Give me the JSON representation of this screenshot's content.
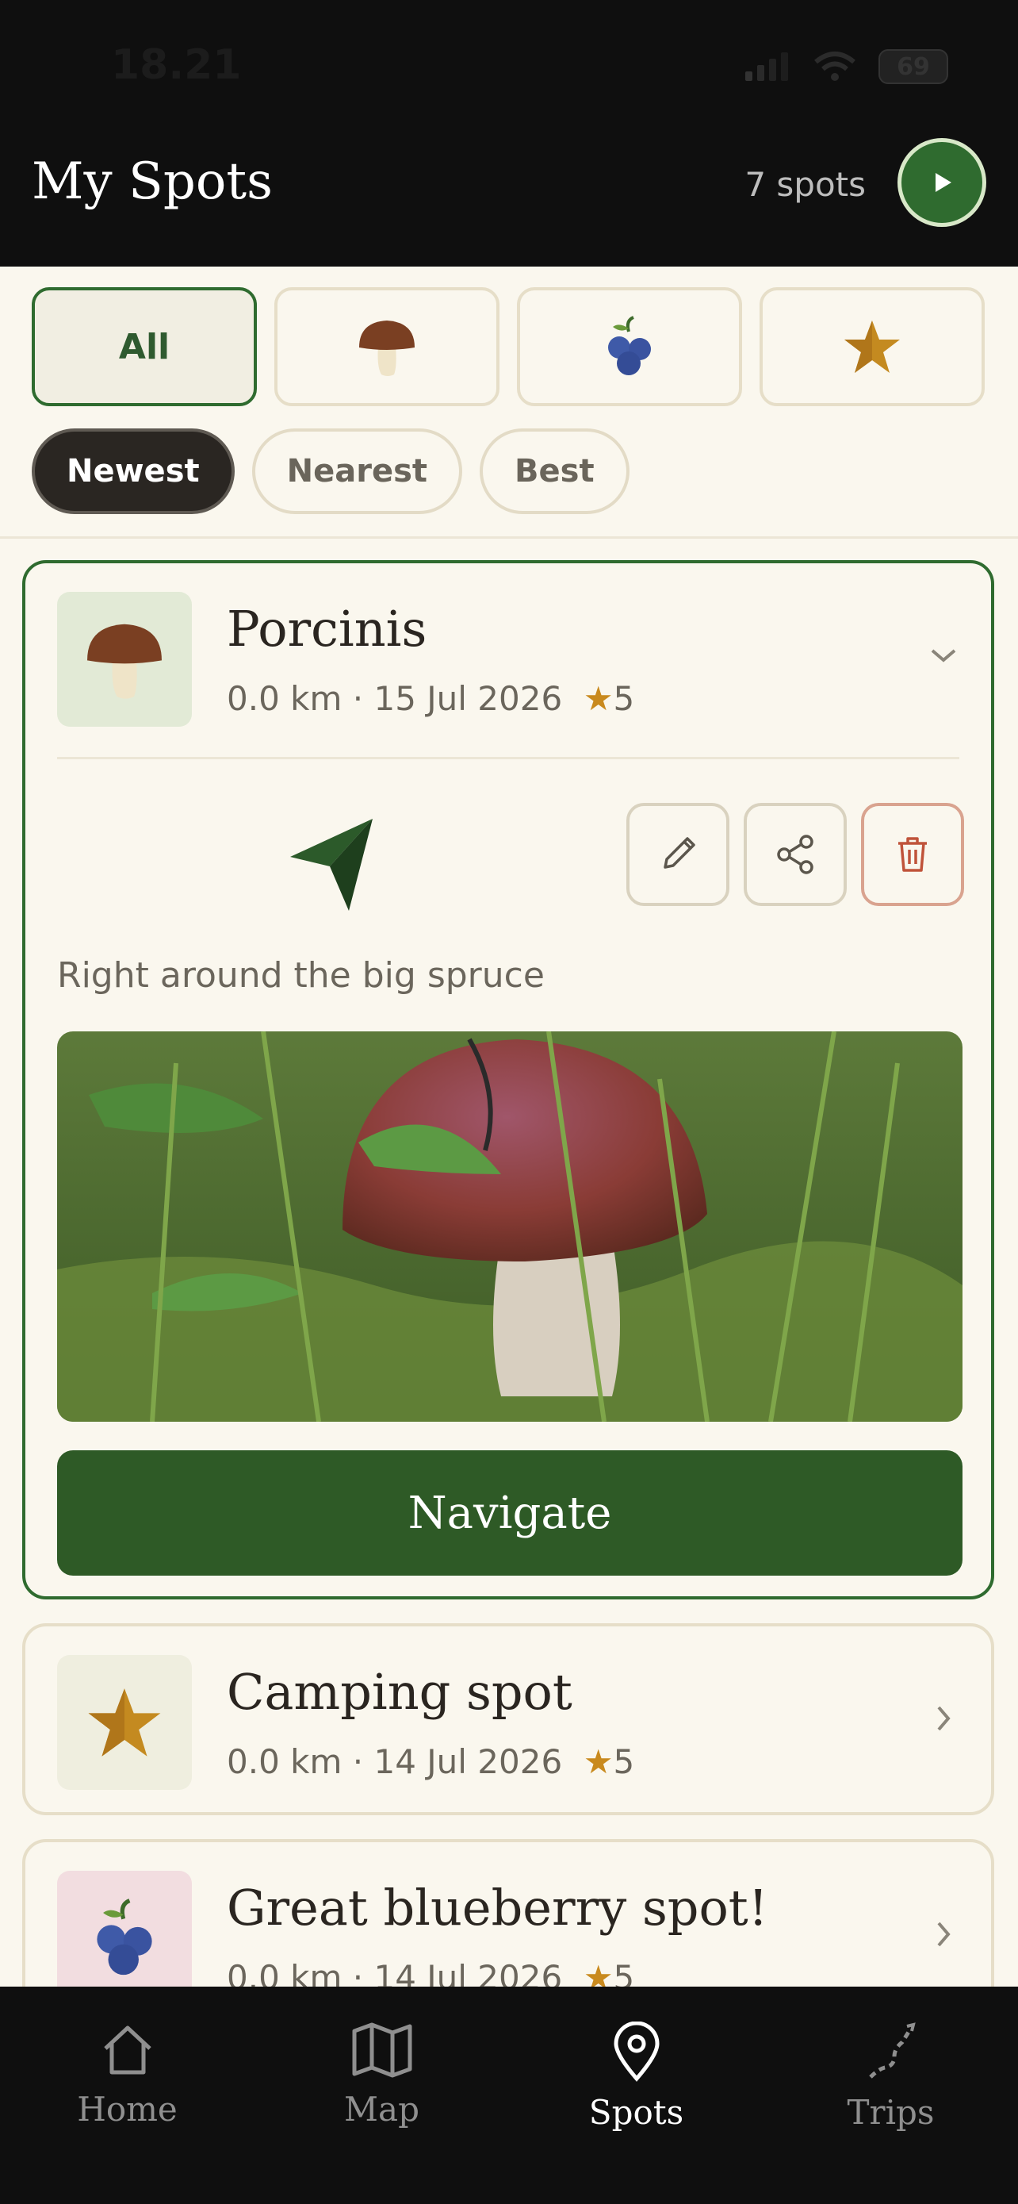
{
  "status_bar": {
    "time": "18.21",
    "battery": "69"
  },
  "header": {
    "title": "My Spots",
    "spot_count": "7 spots"
  },
  "filters": [
    {
      "label": "All",
      "icon": null,
      "active": true
    },
    {
      "label": "",
      "icon": "mushroom-icon",
      "active": false
    },
    {
      "label": "",
      "icon": "blueberry-icon",
      "active": false
    },
    {
      "label": "",
      "icon": "star-icon",
      "active": false
    }
  ],
  "sort_options": [
    {
      "label": "Newest",
      "active": true
    },
    {
      "label": "Nearest",
      "active": false
    },
    {
      "label": "Best",
      "active": false
    }
  ],
  "spots": [
    {
      "title": "Porcinis",
      "distance": "0.0 km",
      "date": "15 Jul 2026",
      "rating": "5",
      "icon": "mushroom-icon",
      "expanded": true,
      "note": "Right around the big spruce",
      "navigate_label": "Navigate"
    },
    {
      "title": "Camping spot",
      "distance": "0.0 km",
      "date": "14 Jul 2026",
      "rating": "5",
      "icon": "star-icon",
      "expanded": false
    },
    {
      "title": "Great blueberry spot!",
      "distance": "0.0 km",
      "date": "14 Jul 2026",
      "rating": "5",
      "icon": "blueberry-icon",
      "expanded": false
    }
  ],
  "meta_separator": "·",
  "star_glyph": "★",
  "tabs": [
    {
      "label": "Home",
      "icon": "home-icon",
      "active": false
    },
    {
      "label": "Map",
      "icon": "map-icon",
      "active": false
    },
    {
      "label": "Spots",
      "icon": "pin-icon",
      "active": true
    },
    {
      "label": "Trips",
      "icon": "trail-icon",
      "active": false
    }
  ],
  "colors": {
    "accent": "#2f6b2f",
    "navigate": "#2e5a26",
    "star": "#c98a1e",
    "danger": "#c0533a",
    "background": "#faf7ee"
  }
}
